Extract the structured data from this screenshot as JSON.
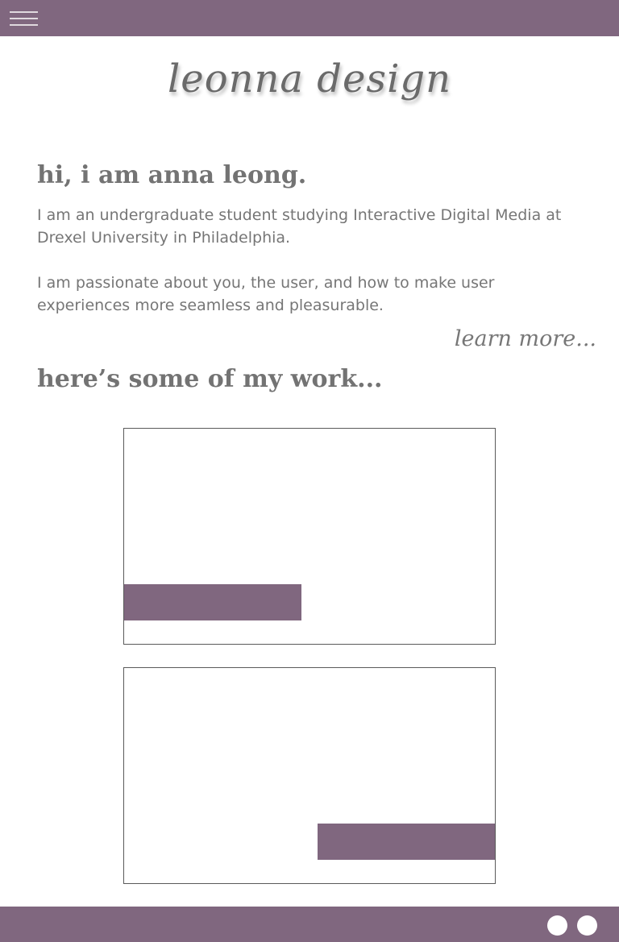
{
  "header": {
    "menu_icon": "hamburger-menu-icon",
    "brand_color": "#80677f"
  },
  "logo": {
    "text": "leonna design"
  },
  "intro": {
    "heading": "hi, i am anna leong.",
    "paragraph_1": "I am an undergraduate student studying Interactive Digital Media at Drexel University in Philadelphia.",
    "paragraph_2": "I am passionate about you, the user, and how to make user experiences more seamless and pleasurable.",
    "learn_more": "learn more..."
  },
  "work": {
    "heading": "here’s some of my work...",
    "projects": [
      {
        "label": ""
      },
      {
        "label": ""
      }
    ]
  },
  "footer": {
    "social_icons": [
      "social-circle-icon",
      "social-circle-icon"
    ]
  }
}
